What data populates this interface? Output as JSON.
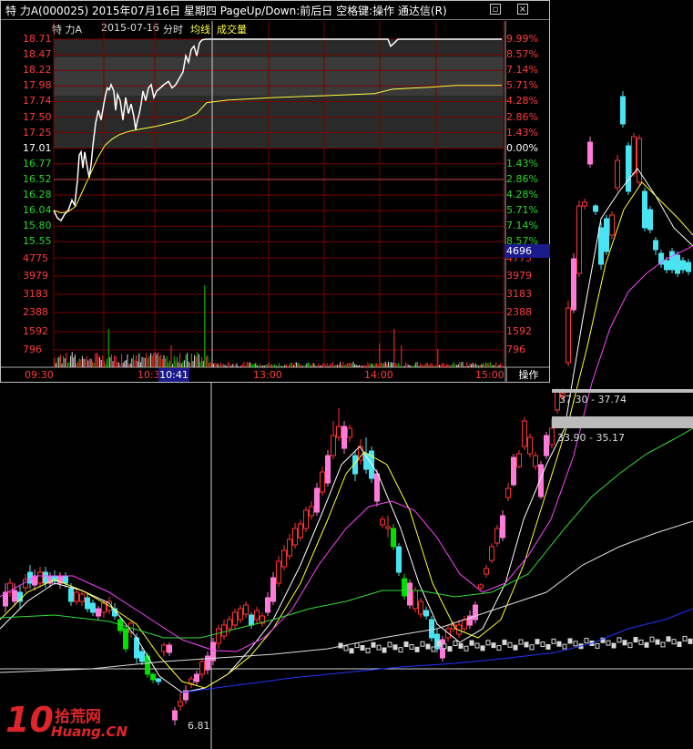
{
  "popup": {
    "title": "特 力A(000025) 2015年07月16日 星期四 PageUp/Down:前后日 空格键:操作 通达信(R)",
    "header": {
      "stock": "特 力A",
      "date": "2015-07-16",
      "period": "分时",
      "avg_line": "均线",
      "volume": "成交量"
    },
    "price_labels": [
      "18.71",
      "18.47",
      "18.22",
      "17.98",
      "17.74",
      "17.50",
      "17.25",
      "17.01",
      "16.77",
      "16.52",
      "16.28",
      "16.04",
      "15.80",
      "15.55"
    ],
    "pct_labels": [
      "9.99%",
      "8.57%",
      "7.14%",
      "5.71%",
      "4.28%",
      "2.86%",
      "1.43%",
      "0.00%",
      "1.43%",
      "2.86%",
      "4.28%",
      "5.71%",
      "7.14%",
      "8.57%"
    ],
    "volume_labels": [
      "4775",
      "3979",
      "3183",
      "2388",
      "1592",
      "796"
    ],
    "time_labels": [
      "09:30",
      "10:3",
      "13:00",
      "14:00",
      "15:00"
    ],
    "cursor_time": "10:41",
    "cursor_value": "4696",
    "operate_button": "操作",
    "colors": {
      "up": "#ff3232",
      "down": "#00d200",
      "price_line": "#ffffff",
      "avg_line": "#ffff44",
      "grid": "#7a0000"
    }
  },
  "main_chart": {
    "annotations": {
      "band_top": "37.30 - 37.74",
      "band_bottom": "33.90 - 35.17",
      "low": "6.81"
    },
    "colors": {
      "up": "#ff3333",
      "down_cyan": "#49e3f1",
      "up_pink": "#ff7ad9",
      "down_green": "#00e000",
      "ma5": "#ffffff",
      "ma10": "#ffff33",
      "ma20": "#ff44ff",
      "ma30": "#33dd33",
      "ma60": "#dddddd",
      "ma120": "#2233ff"
    }
  },
  "watermark": {
    "logo_number": "10",
    "logo_text": "拾荒网",
    "logo_url": "Huang.CN"
  }
}
